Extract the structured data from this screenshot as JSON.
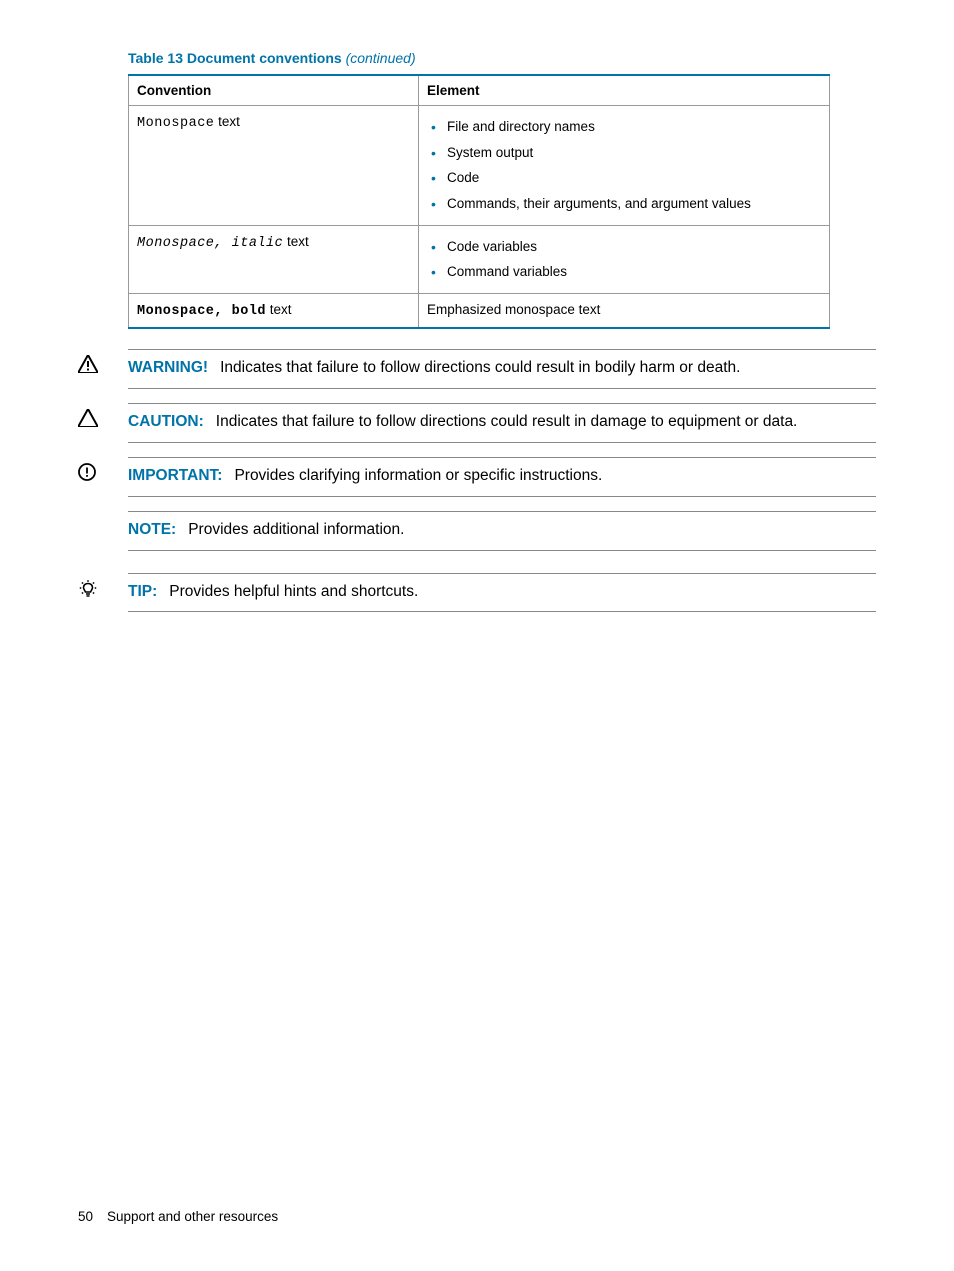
{
  "table": {
    "caption_prefix": "Table 13 Document conventions",
    "caption_suffix": "(continued)",
    "headers": {
      "convention": "Convention",
      "element": "Element"
    },
    "rows": [
      {
        "conv_mono": "Monospace",
        "conv_rest": " text",
        "items": [
          "File and directory names",
          "System output",
          "Code",
          "Commands, their arguments, and argument values"
        ]
      },
      {
        "conv_mono": "Monospace, italic",
        "conv_rest": " text",
        "items": [
          "Code variables",
          "Command variables"
        ]
      },
      {
        "conv_mono": "Monospace, bold",
        "conv_rest": " text",
        "element_text": "Emphasized monospace text"
      }
    ]
  },
  "admonitions": {
    "warning": {
      "label": "WARNING!",
      "text": "Indicates that failure to follow directions could result in bodily harm or death."
    },
    "caution": {
      "label": "CAUTION:",
      "text": "Indicates that failure to follow directions could result in damage to equipment or data."
    },
    "important": {
      "label": "IMPORTANT:",
      "text": "Provides clarifying information or specific instructions."
    },
    "note": {
      "label": "NOTE:",
      "text": "Provides additional information."
    },
    "tip": {
      "label": "TIP:",
      "text": "Provides helpful hints and shortcuts."
    }
  },
  "footer": {
    "page_number": "50",
    "section": "Support and other resources"
  }
}
